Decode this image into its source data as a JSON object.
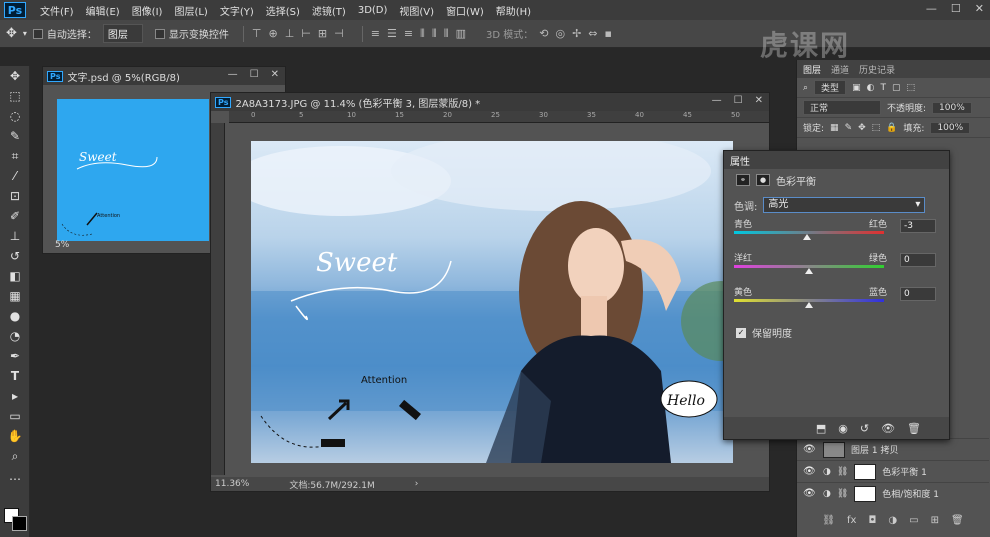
{
  "app": {
    "logo": "Ps",
    "menu": [
      "文件(F)",
      "编辑(E)",
      "图像(I)",
      "图层(L)",
      "文字(Y)",
      "选择(S)",
      "滤镜(T)",
      "3D(D)",
      "视图(V)",
      "窗口(W)",
      "帮助(H)"
    ]
  },
  "options": {
    "auto_select_label": "自动选择：",
    "auto_select_value": "图层",
    "show_transform_label": "显示变换控件",
    "mode_3d_label": "3D 模式："
  },
  "doc1": {
    "title": "文字.psd @ 5%(RGB/8)",
    "zoom": "5%"
  },
  "doc2": {
    "title": "2A8A3173.JPG @ 11.4% (色彩平衡 3, 图层蒙版/8) *",
    "zoom": "11.36%",
    "doc_info": "文档:56.7M/292.1M",
    "ruler_marks": [
      "0",
      "5",
      "10",
      "15",
      "20",
      "25",
      "30",
      "35",
      "40",
      "45",
      "50"
    ],
    "photo_text": {
      "sweet": "Sweet",
      "attention": "Attention",
      "hello": "Hello"
    }
  },
  "properties": {
    "tab": "属性",
    "heading": "色彩平衡",
    "tone_label": "色调:",
    "tone_value": "高光",
    "sliders": [
      {
        "left": "青色",
        "right": "红色",
        "value": "-3",
        "level": -3
      },
      {
        "left": "洋红",
        "right": "绿色",
        "value": "0",
        "level": 0
      },
      {
        "left": "黄色",
        "right": "蓝色",
        "value": "0",
        "level": 0
      }
    ],
    "preserve_label": "保留明度"
  },
  "layers_panel": {
    "tabs": [
      "图层",
      "通道",
      "历史记录"
    ],
    "filter": "类型",
    "blend_mode": "正常",
    "opacity_label": "不透明度:",
    "opacity_value": "100%",
    "lock_label": "锁定:",
    "fill_label": "填充:",
    "fill_value": "100%",
    "layers": [
      {
        "name": "图层 1 拷贝"
      },
      {
        "name": "色彩平衡 1"
      },
      {
        "name": "色相/饱和度 1"
      }
    ]
  },
  "watermark": "虎课网"
}
